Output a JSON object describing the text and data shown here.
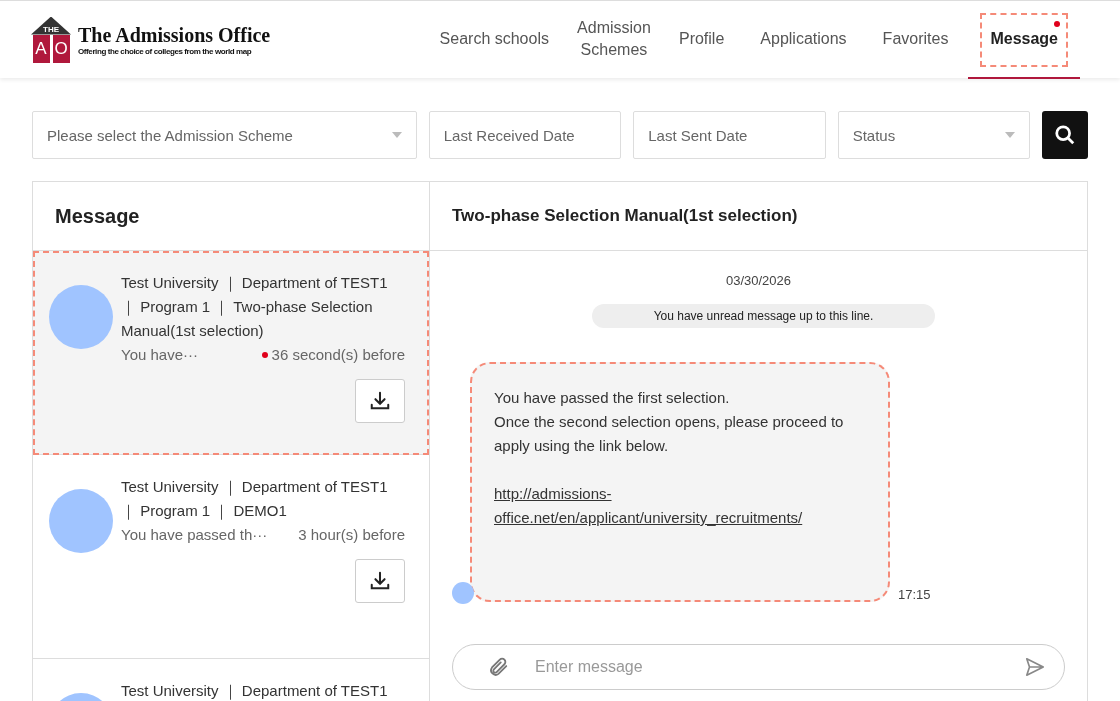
{
  "logo": {
    "roof": "THE",
    "letters": [
      "A",
      "O"
    ],
    "name": "The Admissions Office",
    "tagline": "Offering the choice of colleges from the world map"
  },
  "nav": [
    {
      "label": "Search schools",
      "selected": false,
      "unread": false
    },
    {
      "label": "Admission Schemes",
      "selected": false,
      "unread": false
    },
    {
      "label": "Profile",
      "selected": false,
      "unread": false
    },
    {
      "label": "Applications",
      "selected": false,
      "unread": false
    },
    {
      "label": "Favorites",
      "selected": false,
      "unread": false
    },
    {
      "label": "Message",
      "selected": true,
      "unread": true
    }
  ],
  "filters": [
    {
      "kind": "select",
      "placeholder": "Please select the Admission Scheme"
    },
    {
      "kind": "date",
      "placeholder": "Last Received Date"
    },
    {
      "kind": "date",
      "placeholder": "Last Sent Date"
    },
    {
      "kind": "select",
      "placeholder": "Status"
    }
  ],
  "threads_title": "Message",
  "threads": [
    {
      "title": "Test University ｜ Department of TEST1 ｜ Program 1 ｜ Two-phase Selection Manual(1st selection)",
      "preview": "You have···",
      "time": "36 second(s) before",
      "unread": true,
      "selected": true
    },
    {
      "title": "Test University ｜ Department of TEST1 ｜ Program 1 ｜ DEMO1",
      "preview": "You have passed th···",
      "time": "3 hour(s) before",
      "unread": false,
      "selected": false
    },
    {
      "title": "Test University ｜ Department of TEST1",
      "selected": false
    }
  ],
  "conversation": {
    "title": "Two-phase Selection Manual(1st selection)",
    "date": "03/30/2026",
    "unread_marker": "You have unread message up to this line.",
    "messages": [
      {
        "lines": [
          "You have passed the first selection.",
          "Once the second selection opens, please proceed to apply using the link below."
        ],
        "link": "http://admissions-office.net/en/applicant/university_recruitments/",
        "time": "17:15",
        "highlighted": true
      }
    ],
    "input": {
      "placeholder": "Enter message"
    }
  }
}
